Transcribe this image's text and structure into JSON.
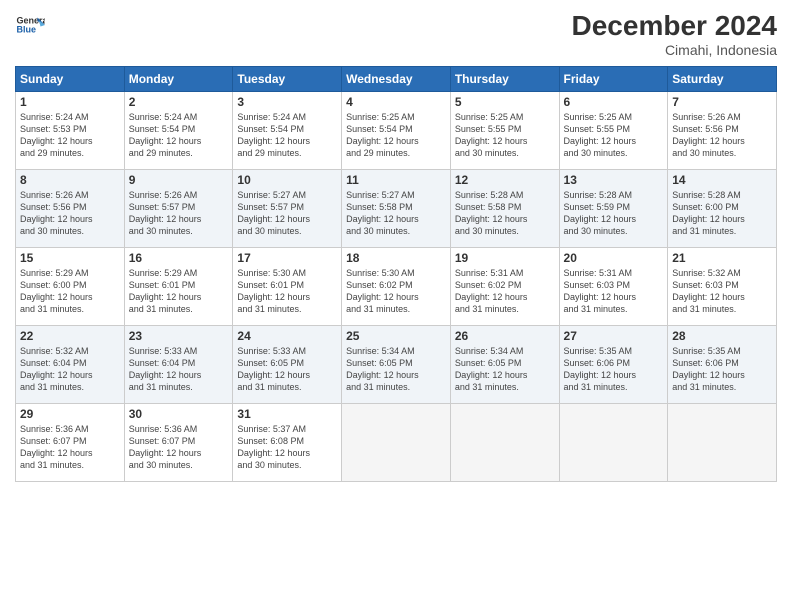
{
  "header": {
    "logo_line1": "General",
    "logo_line2": "Blue",
    "title": "December 2024",
    "subtitle": "Cimahi, Indonesia"
  },
  "days_of_week": [
    "Sunday",
    "Monday",
    "Tuesday",
    "Wednesday",
    "Thursday",
    "Friday",
    "Saturday"
  ],
  "weeks": [
    [
      {
        "day": "1",
        "info": "Sunrise: 5:24 AM\nSunset: 5:53 PM\nDaylight: 12 hours\nand 29 minutes."
      },
      {
        "day": "2",
        "info": "Sunrise: 5:24 AM\nSunset: 5:54 PM\nDaylight: 12 hours\nand 29 minutes."
      },
      {
        "day": "3",
        "info": "Sunrise: 5:24 AM\nSunset: 5:54 PM\nDaylight: 12 hours\nand 29 minutes."
      },
      {
        "day": "4",
        "info": "Sunrise: 5:25 AM\nSunset: 5:54 PM\nDaylight: 12 hours\nand 29 minutes."
      },
      {
        "day": "5",
        "info": "Sunrise: 5:25 AM\nSunset: 5:55 PM\nDaylight: 12 hours\nand 30 minutes."
      },
      {
        "day": "6",
        "info": "Sunrise: 5:25 AM\nSunset: 5:55 PM\nDaylight: 12 hours\nand 30 minutes."
      },
      {
        "day": "7",
        "info": "Sunrise: 5:26 AM\nSunset: 5:56 PM\nDaylight: 12 hours\nand 30 minutes."
      }
    ],
    [
      {
        "day": "8",
        "info": "Sunrise: 5:26 AM\nSunset: 5:56 PM\nDaylight: 12 hours\nand 30 minutes."
      },
      {
        "day": "9",
        "info": "Sunrise: 5:26 AM\nSunset: 5:57 PM\nDaylight: 12 hours\nand 30 minutes."
      },
      {
        "day": "10",
        "info": "Sunrise: 5:27 AM\nSunset: 5:57 PM\nDaylight: 12 hours\nand 30 minutes."
      },
      {
        "day": "11",
        "info": "Sunrise: 5:27 AM\nSunset: 5:58 PM\nDaylight: 12 hours\nand 30 minutes."
      },
      {
        "day": "12",
        "info": "Sunrise: 5:28 AM\nSunset: 5:58 PM\nDaylight: 12 hours\nand 30 minutes."
      },
      {
        "day": "13",
        "info": "Sunrise: 5:28 AM\nSunset: 5:59 PM\nDaylight: 12 hours\nand 30 minutes."
      },
      {
        "day": "14",
        "info": "Sunrise: 5:28 AM\nSunset: 6:00 PM\nDaylight: 12 hours\nand 31 minutes."
      }
    ],
    [
      {
        "day": "15",
        "info": "Sunrise: 5:29 AM\nSunset: 6:00 PM\nDaylight: 12 hours\nand 31 minutes."
      },
      {
        "day": "16",
        "info": "Sunrise: 5:29 AM\nSunset: 6:01 PM\nDaylight: 12 hours\nand 31 minutes."
      },
      {
        "day": "17",
        "info": "Sunrise: 5:30 AM\nSunset: 6:01 PM\nDaylight: 12 hours\nand 31 minutes."
      },
      {
        "day": "18",
        "info": "Sunrise: 5:30 AM\nSunset: 6:02 PM\nDaylight: 12 hours\nand 31 minutes."
      },
      {
        "day": "19",
        "info": "Sunrise: 5:31 AM\nSunset: 6:02 PM\nDaylight: 12 hours\nand 31 minutes."
      },
      {
        "day": "20",
        "info": "Sunrise: 5:31 AM\nSunset: 6:03 PM\nDaylight: 12 hours\nand 31 minutes."
      },
      {
        "day": "21",
        "info": "Sunrise: 5:32 AM\nSunset: 6:03 PM\nDaylight: 12 hours\nand 31 minutes."
      }
    ],
    [
      {
        "day": "22",
        "info": "Sunrise: 5:32 AM\nSunset: 6:04 PM\nDaylight: 12 hours\nand 31 minutes."
      },
      {
        "day": "23",
        "info": "Sunrise: 5:33 AM\nSunset: 6:04 PM\nDaylight: 12 hours\nand 31 minutes."
      },
      {
        "day": "24",
        "info": "Sunrise: 5:33 AM\nSunset: 6:05 PM\nDaylight: 12 hours\nand 31 minutes."
      },
      {
        "day": "25",
        "info": "Sunrise: 5:34 AM\nSunset: 6:05 PM\nDaylight: 12 hours\nand 31 minutes."
      },
      {
        "day": "26",
        "info": "Sunrise: 5:34 AM\nSunset: 6:05 PM\nDaylight: 12 hours\nand 31 minutes."
      },
      {
        "day": "27",
        "info": "Sunrise: 5:35 AM\nSunset: 6:06 PM\nDaylight: 12 hours\nand 31 minutes."
      },
      {
        "day": "28",
        "info": "Sunrise: 5:35 AM\nSunset: 6:06 PM\nDaylight: 12 hours\nand 31 minutes."
      }
    ],
    [
      {
        "day": "29",
        "info": "Sunrise: 5:36 AM\nSunset: 6:07 PM\nDaylight: 12 hours\nand 31 minutes."
      },
      {
        "day": "30",
        "info": "Sunrise: 5:36 AM\nSunset: 6:07 PM\nDaylight: 12 hours\nand 30 minutes."
      },
      {
        "day": "31",
        "info": "Sunrise: 5:37 AM\nSunset: 6:08 PM\nDaylight: 12 hours\nand 30 minutes."
      },
      null,
      null,
      null,
      null
    ]
  ]
}
